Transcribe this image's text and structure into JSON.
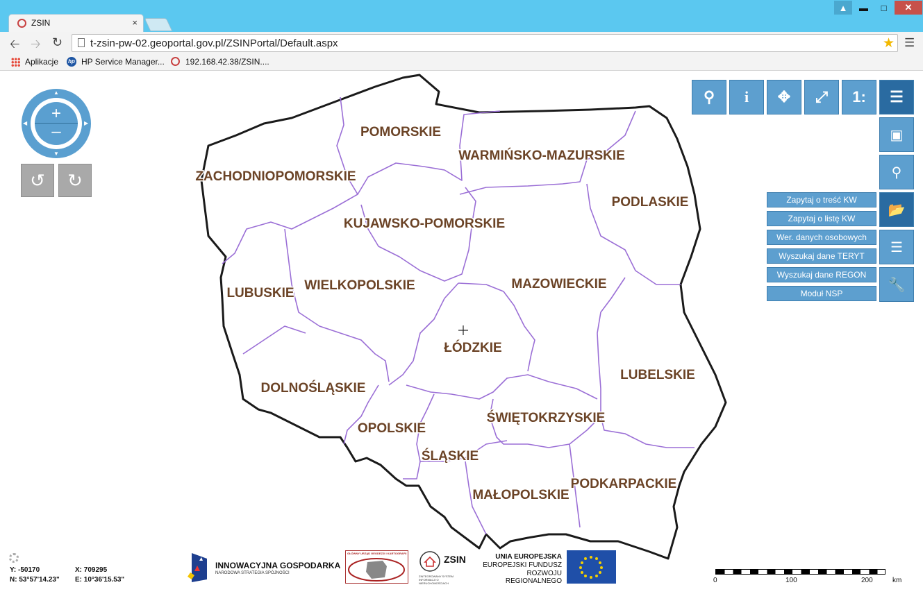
{
  "browser": {
    "tab_title": "ZSIN",
    "tab_close": "×",
    "url": "t-zsin-pw-02.geoportal.gov.pl/ZSINPortal/Default.aspx",
    "bookmarks": [
      "Aplikacje",
      "HP Service Manager...",
      "192.168.42.38/ZSIN...."
    ],
    "icons": [
      "back-icon",
      "forward-icon",
      "reload-icon",
      "star-icon",
      "menu-icon"
    ]
  },
  "map": {
    "regions": [
      "POMORSKIE",
      "WARMIŃSKO-MAZURSKIE",
      "ZACHODNIOPOMORSKIE",
      "PODLASKIE",
      "KUJAWSKO-POMORSKIE",
      "LUBUSKIE",
      "WIELKOPOLSKIE",
      "MAZOWIECKIE",
      "ŁÓDZKIE",
      "LUBELSKIE",
      "DOLNOŚLĄSKIE",
      "ŚWIĘTOKRZYSKIE",
      "OPOLSKIE",
      "ŚLĄSKIE",
      "PODKARPACKIE",
      "MAŁOPOLSKIE"
    ],
    "colors": {
      "border": "#1a1a1a",
      "region_border": "#9b6fd6",
      "label": "#6b4326",
      "tool": "#5d9fcf",
      "tool_active": "#2a6ba1"
    }
  },
  "tools": {
    "scale_label": "1:",
    "query_buttons": [
      "Zapytaj o treść KW",
      "Zapytaj o listę KW",
      "Wer. danych osobowych",
      "Wyszukaj dane TERYT",
      "Wyszukaj dane REGON",
      "Moduł NSP"
    ]
  },
  "footer": {
    "coords": {
      "y": "Y: -50170",
      "x": "X: 709295",
      "n": "N: 53°57'14.23\"",
      "e": "E: 10°36'15.53\""
    },
    "logos": {
      "ig_title": "INNOWACYJNA GOSPODARKA",
      "ig_sub": "NARODOWA STRATEGIA SPÓJNOŚCI",
      "gugik": "GŁÓWNY URZĄD GEODEZJI I KARTOGRAFII",
      "zsin": "ZSIN",
      "zsin_sub": "ZINTEGROWANY SYSTEM INFORMACJI O NIERUCHOMOŚCIACH",
      "eu1": "UNIA EUROPEJSKA",
      "eu2": "EUROPEJSKI FUNDUSZ",
      "eu3": "ROZWOJU REGIONALNEGO"
    },
    "scale": {
      "ticks": [
        "0",
        "100",
        "200"
      ],
      "unit": "km"
    }
  }
}
